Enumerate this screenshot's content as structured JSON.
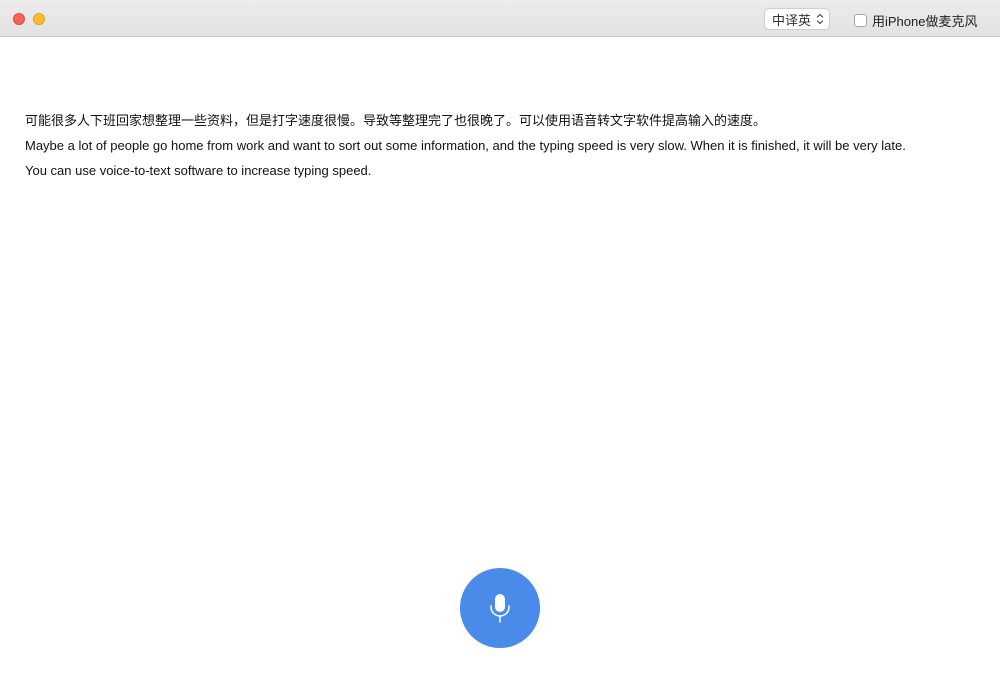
{
  "titlebar": {
    "language_select": {
      "value": "中译英"
    },
    "iphone_mic_toggle": {
      "label": "用iPhone做麦克风",
      "checked": false
    }
  },
  "transcript": {
    "lines": [
      "可能很多人下班回家想整理一些资料，但是打字速度很慢。导致等整理完了也很晚了。可以使用语音转文字软件提高输入的速度。",
      "Maybe a lot of people go home from work and want to sort out some information, and the typing speed is very slow. When it is finished, it will be very late.",
      "You can use voice-to-text software to increase typing speed."
    ]
  },
  "mic_button": {
    "icon": "microphone-icon",
    "color": "#4a8ae8"
  },
  "colors": {
    "close": "#fc5f57",
    "minimize": "#fdbc2e",
    "accent": "#4a8ae8"
  }
}
